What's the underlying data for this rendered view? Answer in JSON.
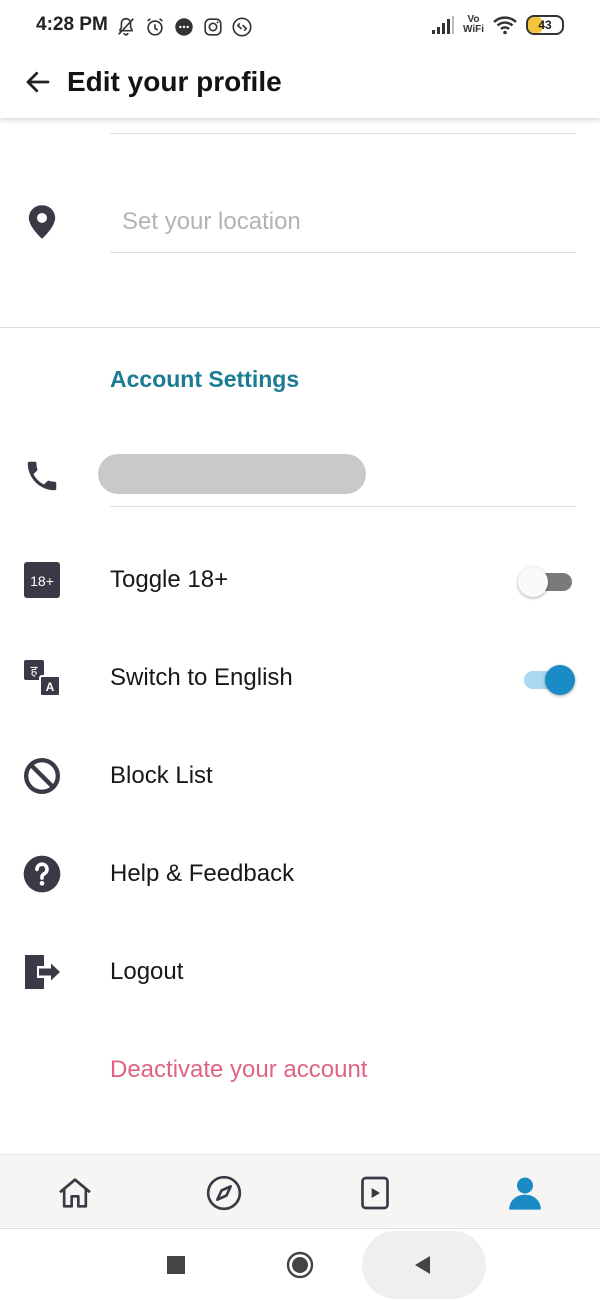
{
  "status_bar": {
    "time": "4:28 PM",
    "wifi_label_top": "Vo",
    "wifi_label_bottom": "WiFi",
    "battery": "43",
    "battery_level": 0.43
  },
  "app_bar": {
    "title": "Edit your profile"
  },
  "location": {
    "placeholder": "Set your location",
    "value": ""
  },
  "account_settings": {
    "title": "Account Settings",
    "items": [
      {
        "label": "Toggle 18+",
        "toggle": false
      },
      {
        "label": "Switch to English",
        "toggle": true
      },
      {
        "label": "Block List"
      },
      {
        "label": "Help & Feedback"
      },
      {
        "label": "Logout"
      }
    ],
    "deactivate_label": "Deactivate your account",
    "icon_18_label": "18+",
    "icon_lang_top": "ह",
    "icon_lang_bottom": "A"
  },
  "bottom_nav": {
    "items": [
      {
        "icon": "home-icon",
        "active": false
      },
      {
        "icon": "compass-icon",
        "active": false
      },
      {
        "icon": "play-icon",
        "active": false
      },
      {
        "icon": "profile-icon",
        "active": true
      }
    ]
  },
  "colors": {
    "accent": "#1a7b93",
    "toggle_on": "#1a8bc4",
    "deactivate": "#e06481",
    "icon_dark": "#3a3a46"
  }
}
